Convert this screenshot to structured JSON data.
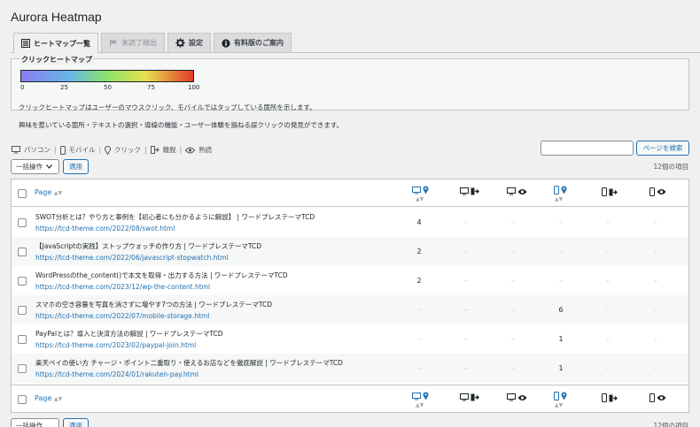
{
  "app_title": "Aurora Heatmap",
  "tabs": [
    {
      "label": "ヒートマップ一覧",
      "icon": "list-icon"
    },
    {
      "label": "未読了検出",
      "icon": "flag-icon"
    },
    {
      "label": "設定",
      "icon": "gear-icon"
    },
    {
      "label": "有料版のご案内",
      "icon": "info-icon"
    }
  ],
  "panel": {
    "title": "クリックヒートマップ",
    "scale": [
      "0",
      "25",
      "50",
      "75",
      "100"
    ],
    "desc1": "クリックヒートマップはユーザーのマウスクリック、モバイルではタップしている箇所を示します。",
    "desc2": "興味を惹いている箇所・テキストの選択・導線の機能・ユーザー体験を損ねる誤クリックの発見ができます。"
  },
  "legend": {
    "pc": "パソコン",
    "mobile": "モバイル",
    "click": "クリック",
    "exit": "離脱",
    "read": "熟読"
  },
  "search": {
    "placeholder": "",
    "button": "ページを検索"
  },
  "bulk": {
    "label": "一括操作",
    "apply": "適用"
  },
  "item_count": "12個の項目",
  "table": {
    "page_header": "Page",
    "rows": [
      {
        "title": "SWOT分析とは？やり方と事例を【初心者にも分かるように解説】 | ワードプレステーマTCD",
        "url": "https://tcd-theme.com/2022/08/swot.html",
        "cells": [
          "4",
          "–",
          "–",
          "–",
          "–",
          "–"
        ]
      },
      {
        "title": "【JavaScriptの実践】ストップウォッチの作り方 | ワードプレステーマTCD",
        "url": "https://tcd-theme.com/2022/06/javascript-stopwatch.html",
        "cells": [
          "2",
          "–",
          "–",
          "–",
          "–",
          "–"
        ]
      },
      {
        "title": "WordPressのthe_content()で本文を取得・出力する方法 | ワードプレステーマTCD",
        "url": "https://tcd-theme.com/2023/12/wp-the-content.html",
        "cells": [
          "2",
          "–",
          "–",
          "–",
          "–",
          "–"
        ]
      },
      {
        "title": "スマホの空き容量を写真を消さずに増やす7つの方法 | ワードプレステーマTCD",
        "url": "https://tcd-theme.com/2022/07/mobile-storage.html",
        "cells": [
          "–",
          "–",
          "–",
          "6",
          "–",
          "–"
        ]
      },
      {
        "title": "PayPalとは？導入と決済方法の解説 | ワードプレステーマTCD",
        "url": "https://tcd-theme.com/2023/02/paypal-join.html",
        "cells": [
          "–",
          "–",
          "–",
          "1",
          "–",
          "–"
        ]
      },
      {
        "title": "楽天ペイの使い方 チャージ・ポイント二重取り・使えるお店などを徹底解説 | ワードプレステーマTCD",
        "url": "https://tcd-theme.com/2024/01/rakuten-pay.html",
        "cells": [
          "–",
          "–",
          "–",
          "1",
          "–",
          "–"
        ]
      }
    ]
  },
  "colors": {
    "accent": "#2271b1",
    "border": "#c3c4c7",
    "bg": "#f0f0f1"
  }
}
